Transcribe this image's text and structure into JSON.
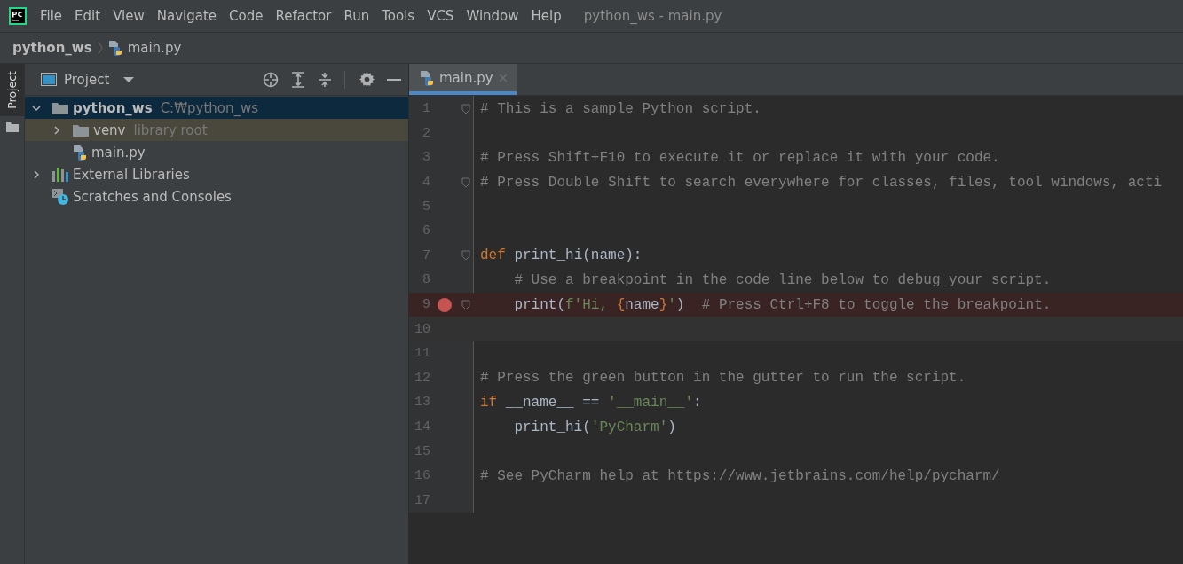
{
  "menu": [
    "File",
    "Edit",
    "View",
    "Navigate",
    "Code",
    "Refactor",
    "Run",
    "Tools",
    "VCS",
    "Window",
    "Help"
  ],
  "window": {
    "title": "python_ws - main.py"
  },
  "breadcrumb": [
    {
      "label": "python_ws",
      "kind": "folder"
    },
    {
      "label": "main.py",
      "kind": "python"
    }
  ],
  "tool_strip": [
    {
      "label": "Project",
      "selected": true
    }
  ],
  "project_panel": {
    "title": "Project",
    "tree": [
      {
        "label": "python_ws",
        "hint": "C:₩python_ws",
        "kind": "root",
        "expanded": true,
        "selected": true,
        "children": [
          {
            "label": "venv",
            "hint": "library root",
            "kind": "folder",
            "expanded": false,
            "selected": false
          },
          {
            "label": "main.py",
            "kind": "python",
            "selected": false
          }
        ]
      },
      {
        "label": "External Libraries",
        "kind": "libraries",
        "expanded": false,
        "selected": false
      },
      {
        "label": "Scratches and Consoles",
        "kind": "scratches",
        "selected": false
      }
    ]
  },
  "tabs": [
    {
      "label": "main.py",
      "selected": true
    }
  ],
  "editor": {
    "lines": [
      {
        "number": "1",
        "fold": true,
        "tokens": [
          {
            "kind": "comment",
            "text": "# This is a sample Python script."
          }
        ]
      },
      {
        "number": "2"
      },
      {
        "number": "3",
        "tokens": [
          {
            "kind": "comment",
            "text": "# Press Shift+F10 to execute it or replace it with your code."
          }
        ]
      },
      {
        "number": "4",
        "fold": true,
        "tokens": [
          {
            "kind": "comment",
            "text": "# Press Double Shift to search everywhere for classes, files, tool windows, acti"
          }
        ]
      },
      {
        "number": "5"
      },
      {
        "number": "6"
      },
      {
        "number": "7",
        "fold": true,
        "tokens": [
          {
            "kind": "keyword",
            "text": "def"
          },
          {
            "kind": "plain",
            "text": " print_hi(name):"
          }
        ]
      },
      {
        "number": "8",
        "tokens": [
          {
            "kind": "comment",
            "text": "    # Use a breakpoint in the code line below to debug your script."
          }
        ]
      },
      {
        "number": "9",
        "fold": true,
        "breakpoint": true,
        "tokens": [
          {
            "kind": "plain",
            "text": "    print("
          },
          {
            "kind": "string",
            "text": "f'Hi, "
          },
          {
            "kind": "brace",
            "text": "{"
          },
          {
            "kind": "plain",
            "text": "name"
          },
          {
            "kind": "brace",
            "text": "}"
          },
          {
            "kind": "string",
            "text": "'"
          },
          {
            "kind": "plain",
            "text": ")  "
          },
          {
            "kind": "comment",
            "text": "# Press Ctrl+F8 to toggle the breakpoint."
          }
        ]
      },
      {
        "number": "10",
        "current": true
      },
      {
        "number": "11"
      },
      {
        "number": "12",
        "tokens": [
          {
            "kind": "comment",
            "text": "# Press the green button in the gutter to run the script."
          }
        ]
      },
      {
        "number": "13",
        "tokens": [
          {
            "kind": "keyword",
            "text": "if"
          },
          {
            "kind": "plain",
            "text": " __name__ == "
          },
          {
            "kind": "string",
            "text": "'__main__'"
          },
          {
            "kind": "plain",
            "text": ":"
          }
        ]
      },
      {
        "number": "14",
        "tokens": [
          {
            "kind": "plain",
            "text": "    print_hi("
          },
          {
            "kind": "string",
            "text": "'PyCharm'"
          },
          {
            "kind": "plain",
            "text": ")"
          }
        ]
      },
      {
        "number": "15"
      },
      {
        "number": "16",
        "tokens": [
          {
            "kind": "comment",
            "text": "# See PyCharm help at https://www.jetbrains.com/help/pycharm/"
          }
        ]
      },
      {
        "number": "17"
      }
    ]
  }
}
